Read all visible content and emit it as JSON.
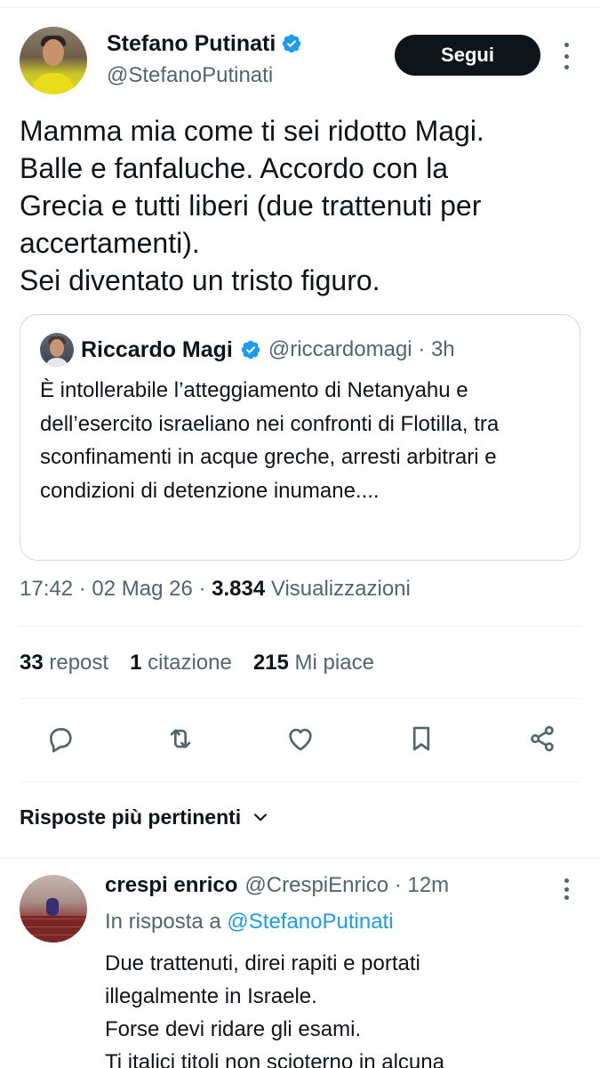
{
  "author": {
    "name": "Stefano Putinati",
    "handle": "@StefanoPutinati",
    "follow_label": "Segui"
  },
  "tweet": {
    "text": "Mamma mia come ti sei ridotto Magi.\nBalle e fanfaluche. Accordo con la\nGrecia e tutti liberi (due trattenuti per\naccertamenti).\nSei diventato un tristo figuro."
  },
  "quote": {
    "name": "Riccardo Magi",
    "handle_time": "@riccardomagi · 3h",
    "text": "È intollerabile l’atteggiamento di Netanyahu e dell’esercito israeliano nei confronti di Flotilla, tra sconfinamenti in acque greche, arresti arbitrari e condizioni di detenzione inumane...."
  },
  "meta": {
    "time_date": "17:42 · 02 Mag 26 · ",
    "views_count": "3.834",
    "views_label": " Visualizzazioni"
  },
  "stats": {
    "reposts_count": "33",
    "reposts_label": " repost",
    "quotes_count": "1",
    "quotes_label": " citazione",
    "likes_count": "215",
    "likes_label": " Mi piace"
  },
  "actions": [
    "reply-icon",
    "repost-icon",
    "like-icon",
    "bookmark-icon",
    "share-icon"
  ],
  "sort": {
    "label": "Risposte più pertinenti"
  },
  "reply": {
    "name": "crespi enrico",
    "handle_time": "@CrespiEnrico · 12m",
    "in_reply_prefix": "In risposta a ",
    "in_reply_mention": "@StefanoPutinati",
    "text": "Due trattenuti, direi rapiti e portati\nillegalmente in Israele.\nForse devi ridare gli esami.\nTi italici titoli non scioterno in alcuna"
  },
  "colors": {
    "verified": "#1d9bf0",
    "text_primary": "#0f1419",
    "text_secondary": "#536471",
    "mention": "#1d9bf0",
    "button_bg": "#0f1419"
  }
}
